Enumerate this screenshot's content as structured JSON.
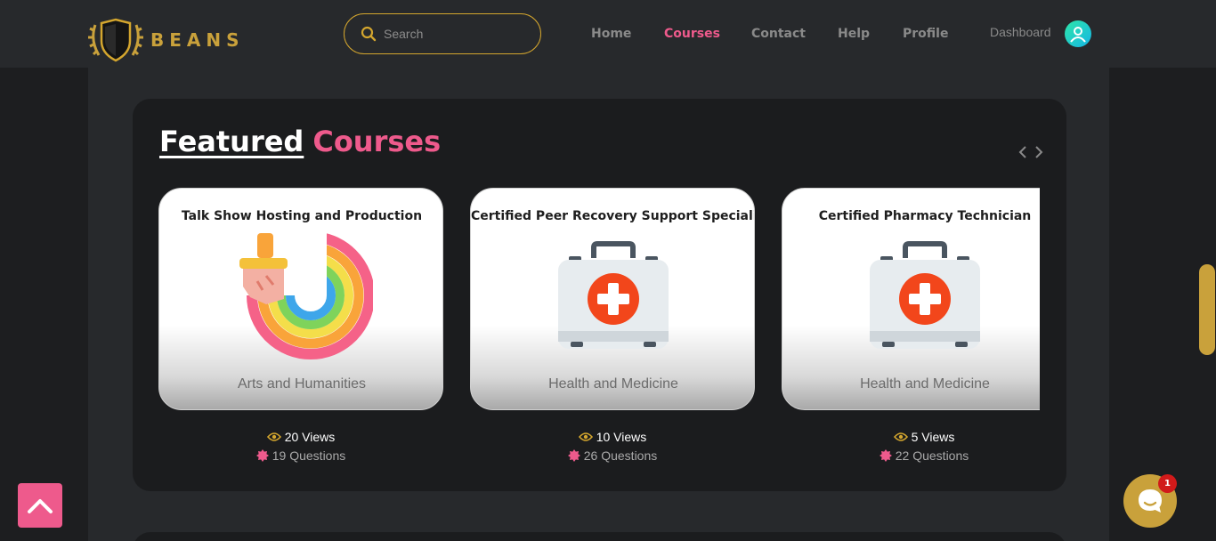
{
  "header": {
    "logo_text": "BEANS",
    "search_placeholder": "Search",
    "nav": [
      "Home",
      "Courses",
      "Contact",
      "Help",
      "Profile"
    ],
    "active_nav": "Courses",
    "dashboard_label": "Dashboard"
  },
  "featured": {
    "title_word1": "Featured",
    "title_word2": "Courses",
    "cards": [
      {
        "title": "Talk Show Hosting and Production",
        "icon": "paint-brush-rainbow-icon",
        "category": "Arts and Humanities",
        "views": "20 Views",
        "questions": "19 Questions"
      },
      {
        "title": "Certified Peer Recovery Support Specialist",
        "icon": "first-aid-kit-icon",
        "category": "Health and Medicine",
        "views": "10 Views",
        "questions": "26 Questions"
      },
      {
        "title": "Certified Pharmacy Technician",
        "icon": "first-aid-kit-icon",
        "category": "Health and Medicine",
        "views": "5 Views",
        "questions": "22 Questions"
      }
    ]
  },
  "chat": {
    "badge": "1"
  },
  "colors": {
    "accent_gold": "#c9a13b",
    "accent_pink": "#ee5a8c",
    "header_bg": "#27292c",
    "page_bg": "#1d1e20"
  }
}
